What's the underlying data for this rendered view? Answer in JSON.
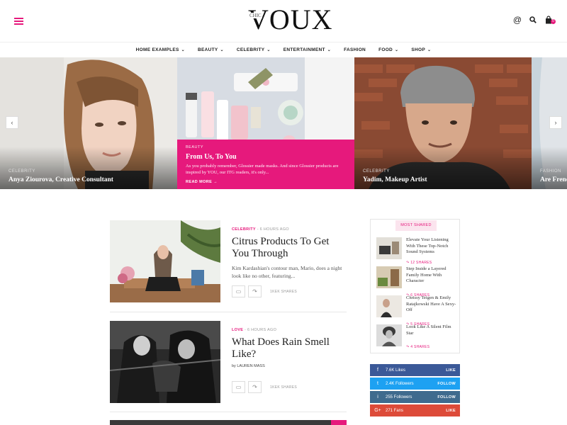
{
  "header": {
    "logo_small": "CHIC",
    "logo": "VOUX"
  },
  "nav": {
    "items": [
      {
        "label": "HOME EXAMPLES",
        "dropdown": true
      },
      {
        "label": "BEAUTY",
        "dropdown": true
      },
      {
        "label": "CELEBRITY",
        "dropdown": true
      },
      {
        "label": "ENTERTAINMENT",
        "dropdown": true
      },
      {
        "label": "FASHION",
        "dropdown": false
      },
      {
        "label": "FOOD",
        "dropdown": true
      },
      {
        "label": "SHOP",
        "dropdown": true
      }
    ]
  },
  "slider": {
    "slides": [
      {
        "category": "CELEBRITY",
        "title": "Anya Ziourova, Creative Consultant"
      },
      {
        "category": "BEAUTY",
        "title": "From Us, To You",
        "excerpt": "As you probably remember, Glossier made masks. And since Glossier products are inspired by YOU, our ITG readers, it's only...",
        "read_more": "READ MORE"
      },
      {
        "category": "CELEBRITY",
        "title": "Yadim, Makeup Artist"
      },
      {
        "category": "FASHION",
        "title": "Are Frenc"
      }
    ]
  },
  "posts": [
    {
      "category": "CELEBRITY",
      "time": "- 6 HOURS AGO",
      "title": "Citrus Products To Get You Through",
      "excerpt": "Kim Kardashian's contour man, Mario, does a night look like no other, featuring...",
      "shares": "1KEK SHARES"
    },
    {
      "category": "LOVE",
      "time": "- 6 HOURS AGO",
      "title": "What Does Rain Smell Like?",
      "author": "by LAUREN MASS",
      "shares": "1KEK SHARES"
    }
  ],
  "most_shared": {
    "title": "MOST SHARED",
    "items": [
      {
        "text": "Elevate Your Listening With These Top-Notch Sound Systems",
        "shares": "12 SHARES"
      },
      {
        "text": "Step Inside a Layered Family Home With Character",
        "shares": "6 SHARES"
      },
      {
        "text": "Chrissy Teigen & Emily Ratajkowski Have A Sexy-Off",
        "shares": "5 SHARES"
      },
      {
        "text": "Look Like A Silent Film Star",
        "shares": "4 SHARES"
      }
    ]
  },
  "social": [
    {
      "icon": "f",
      "count": "7.6K Likes",
      "action": "LIKE",
      "color": "#3b5998"
    },
    {
      "icon": "t",
      "count": "2.4K Followers",
      "action": "FOLLOW",
      "color": "#1da1f2"
    },
    {
      "icon": "i",
      "count": "255 Followers",
      "action": "FOLLOW",
      "color": "#3f6b8e"
    },
    {
      "icon": "G+",
      "count": "271 Fans",
      "action": "LIKE",
      "color": "#dd4b39"
    }
  ],
  "colors": {
    "accent": "#e6197c"
  }
}
